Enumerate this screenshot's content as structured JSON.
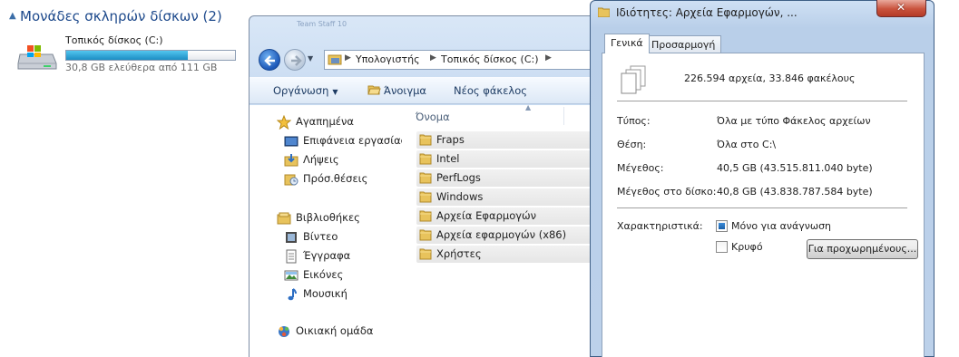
{
  "drives": {
    "section_title": "Μονάδες σκληρών δίσκων (2)",
    "items": [
      {
        "name": "Τοπικός δίσκος (C:)",
        "free_text": "30,8 GB ελεύθερα από 111 GB",
        "used_fraction": 0.72,
        "icon": "hard-drive-windows-icon"
      }
    ]
  },
  "explorer": {
    "caption": "Team Staff 10",
    "breadcrumb": [
      "Υπολογιστής",
      "Τοπικός δίσκος (C:)"
    ],
    "toolbar": {
      "organize": "Οργάνωση",
      "open": "Άνοιγμα",
      "new_folder": "Νέος φάκελος"
    },
    "nav": [
      {
        "label": "Αγαπημένα",
        "icon": "star-icon"
      },
      {
        "label": "Επιφάνεια εργασίας",
        "icon": "desktop-icon"
      },
      {
        "label": "Λήψεις",
        "icon": "downloads-icon"
      },
      {
        "label": "Πρόσ.θέσεις",
        "icon": "recent-places-icon"
      },
      {
        "label": "Βιβλιοθήκες",
        "icon": "libraries-icon"
      },
      {
        "label": "Βίντεο",
        "icon": "video-icon"
      },
      {
        "label": "Έγγραφα",
        "icon": "documents-icon"
      },
      {
        "label": "Εικόνες",
        "icon": "pictures-icon"
      },
      {
        "label": "Μουσική",
        "icon": "music-icon"
      },
      {
        "label": "Οικιακή ομάδα",
        "icon": "homegroup-icon"
      }
    ],
    "column_header": "Όνομα",
    "files": [
      "Fraps",
      "Intel",
      "PerfLogs",
      "Windows",
      "Αρχεία Εφαρμογών",
      "Αρχεία εφαρμογών (x86)",
      "Χρήστες"
    ]
  },
  "dialog": {
    "title": "Ιδιότητες: Αρχεία Εφαρμογών, ...",
    "tabs": [
      "Γενικά",
      "Προσαρμογή"
    ],
    "summary": "226.594 αρχεία, 33.846 φακέλους",
    "props": [
      {
        "label": "Τύπος:",
        "value": "Όλα με τύπο Φάκελος αρχείων"
      },
      {
        "label": "Θέση:",
        "value": "Όλα στο C:\\"
      },
      {
        "label": "Μέγεθος:",
        "value": "40,5 GB (43.515.811.040 byte)"
      },
      {
        "label": "Μέγεθος στο δίσκο:",
        "value": "40,8 GB (43.838.787.584 byte)"
      }
    ],
    "attributes_label": "Χαρακτηριστικά:",
    "readonly_label": "Μόνο για ανάγνωση",
    "hidden_label": "Κρυφό",
    "advanced_button": "Για προχωρημένους..."
  }
}
